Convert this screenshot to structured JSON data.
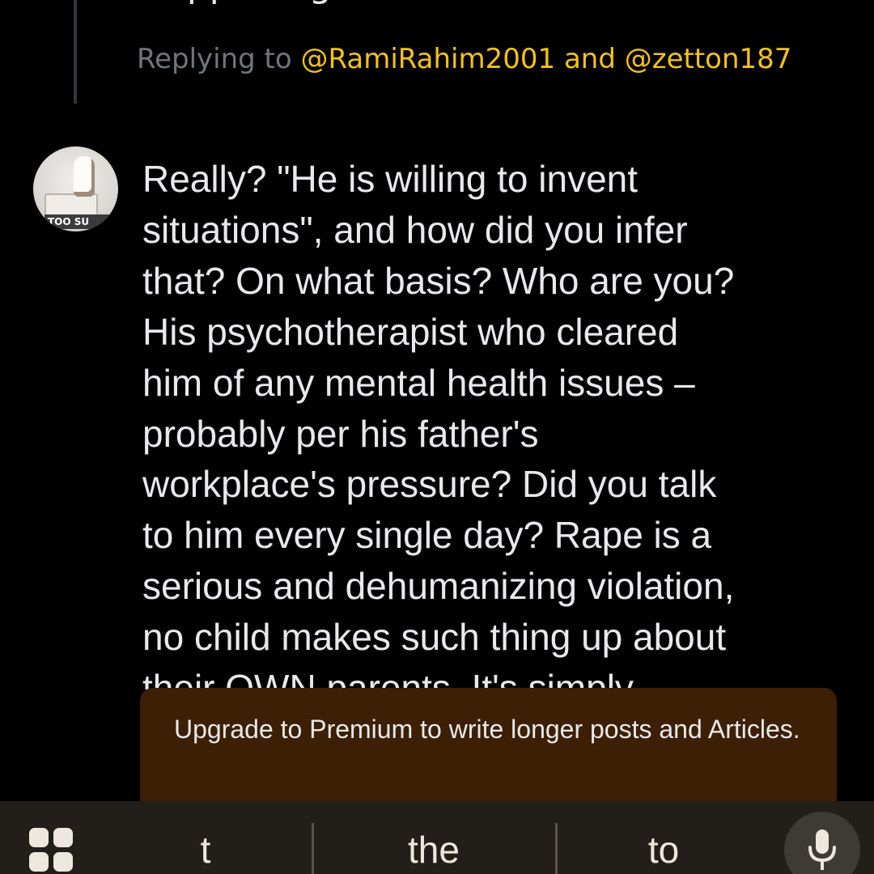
{
  "thread": {
    "partial_previous_text": "happening"
  },
  "reply_context": {
    "prefix": "Replying to",
    "handle_1": "@RamiRahim2001",
    "joiner": "and",
    "handle_2": "@zetton187"
  },
  "avatar": {
    "overlay_text": "TOO SU"
  },
  "post": {
    "text": "Really? \"He is willing to invent\nsituations\", and how did you infer\nthat? On what basis? Who are you?\nHis psychotherapist who cleared\nhim of any mental health issues –\nprobably per his father's\nworkplace's pressure? Did you talk\nto him every single day? Rape is a\nserious and dehumanizing violation,\nno child makes such thing up about\ntheir OWN parents. It's simply"
  },
  "upgrade_notice": {
    "text": "Upgrade to Premium to write longer posts and Articles."
  },
  "keyboard": {
    "suggestions": [
      "t",
      "the",
      "to"
    ],
    "apps_icon": "apps-grid-icon",
    "mic_icon": "microphone-icon"
  },
  "colors": {
    "background": "#000000",
    "text": "#e7e9ea",
    "muted": "#71767b",
    "handle": "#f4c21c",
    "toast_background": "#3d1f06",
    "keyboard_background": "#221f1a"
  }
}
